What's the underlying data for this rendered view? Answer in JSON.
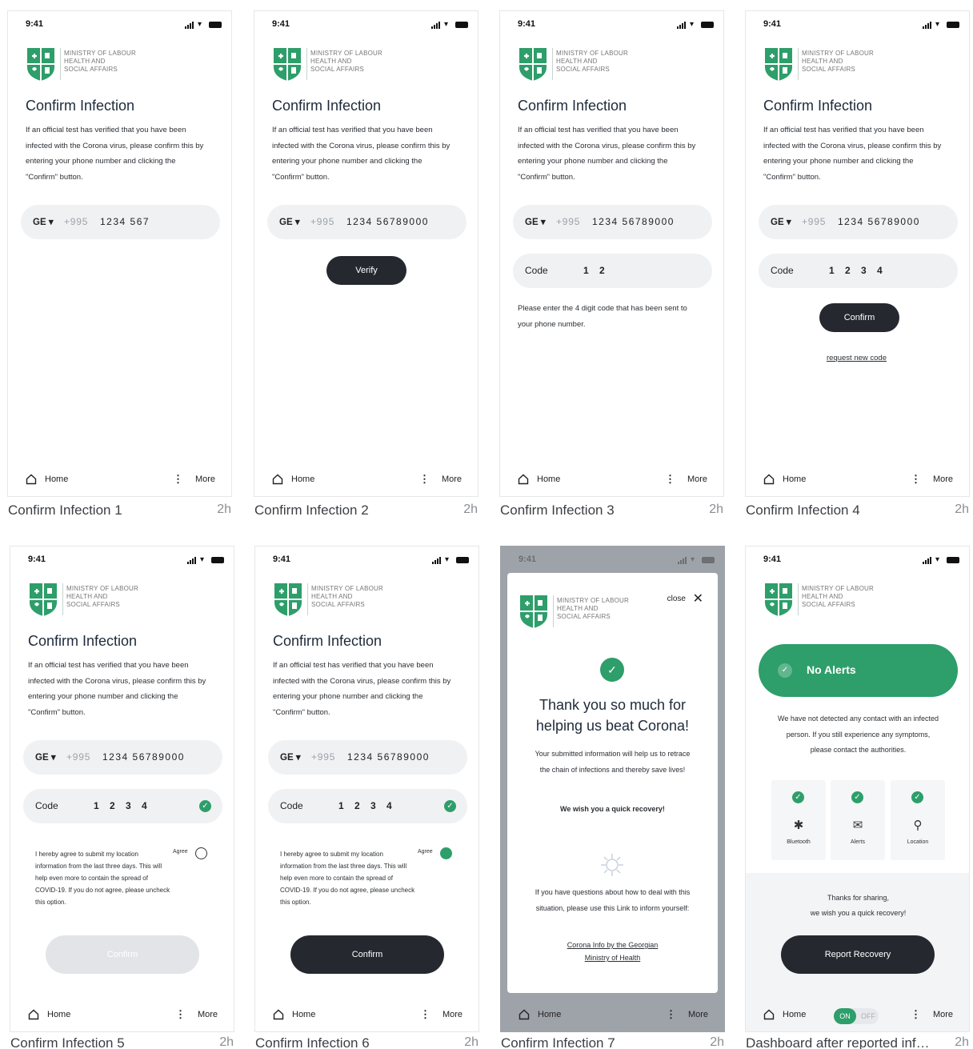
{
  "common": {
    "clock": "9:41",
    "ministry_line1": "MINISTRY OF LABOUR",
    "ministry_line2": "HEALTH AND",
    "ministry_line3": "SOCIAL AFFAIRS",
    "heading": "Confirm Infection",
    "description": "If an official test has verified that you have been infected with the Corona virus, please confirm this by entering your phone number and clicking the \"Confirm\" button.",
    "country_code": "GE",
    "phone_prefix": "+995",
    "code_label": "Code",
    "nav_home": "Home",
    "nav_more": "More",
    "time_ago": "2h",
    "agree_text": "I hereby agree to submit my location information from the last three days. This will help even more to contain the spread of COVID-19. If you do not agree, please uncheck this option.",
    "agree_label": "Agree"
  },
  "screens": [
    {
      "title": "Confirm Infection 1",
      "phone": "1234 567"
    },
    {
      "title": "Confirm Infection 2",
      "phone": "1234 56789000",
      "button": "Verify"
    },
    {
      "title": "Confirm Infection 3",
      "phone": "1234 56789000",
      "code": "1 2",
      "hint": "Please enter the 4 digit code that has been sent to your phone number."
    },
    {
      "title": "Confirm Infection 4",
      "phone": "1234 56789000",
      "code": "1 2 3 4",
      "button": "Confirm",
      "link": "request new code"
    },
    {
      "title": "Confirm Infection 5",
      "phone": "1234 56789000",
      "code": "1 2 3 4",
      "button": "Confirm"
    },
    {
      "title": "Confirm Infection 6",
      "phone": "1234 56789000",
      "code": "1 2 3 4",
      "button": "Confirm"
    },
    {
      "title": "Confirm Infection 7",
      "close": "close",
      "thanks": "Thank you so much for helping us beat Corona!",
      "info": "Your submitted information will help us to retrace the chain of infections and thereby save lives!",
      "wish": "We wish you a quick recovery!",
      "questions": "If you have questions about how to deal with this situation, please use this Link to inform yourself:",
      "link": "Corona Info by the Georgian Ministry of Health"
    },
    {
      "title": "Dashboard after reported infec...",
      "alert": "No Alerts",
      "alert_desc": "We have not detected any contact with an infected person. If you still experience any symptoms, please contact the authorities.",
      "tiles": [
        "Bluetooth",
        "Alerts",
        "Location"
      ],
      "share_line1": "Thanks for sharing,",
      "share_line2": "we wish you a quick recovery!",
      "button": "Report Recovery",
      "toggle_on": "ON",
      "toggle_off": "OFF"
    }
  ],
  "colors": {
    "accent": "#2e9e6a",
    "dark": "#25292f",
    "field": "#f0f1f3"
  }
}
